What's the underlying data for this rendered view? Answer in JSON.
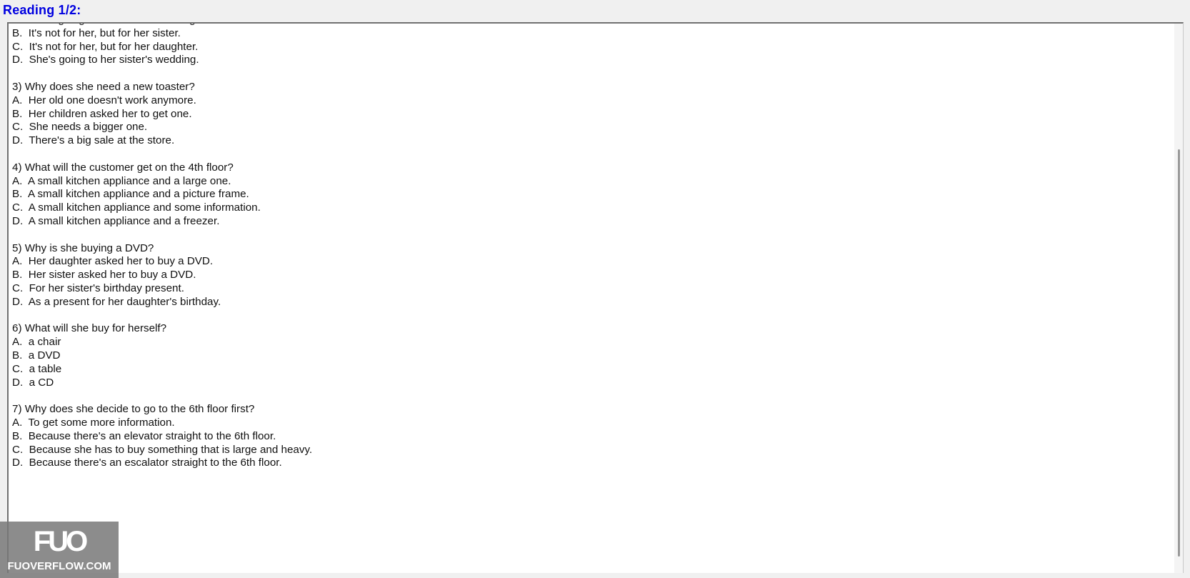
{
  "header": {
    "title": "Reading 1/2:"
  },
  "content": {
    "partial_top": "A.  She's going to her sister's wedding.",
    "questions": [
      {
        "question": null,
        "options": [
          "B.  It's not for her, but for her sister.",
          "C.  It's not for her, but for her daughter.",
          "D.  She's going to her sister's wedding."
        ]
      },
      {
        "question": "3) Why does she need a new toaster?",
        "options": [
          "A.  Her old one doesn't work anymore.",
          "B.  Her children asked her to get one.",
          "C.  She needs a bigger one.",
          "D.  There's a big sale at the store."
        ]
      },
      {
        "question": "4) What will the customer get on the 4th floor?",
        "options": [
          "A.  A small kitchen appliance and a large one.",
          "B.  A small kitchen appliance and a picture frame.",
          "C.  A small kitchen appliance and some information.",
          "D.  A small kitchen appliance and a freezer."
        ]
      },
      {
        "question": "5) Why is she buying a DVD?",
        "options": [
          "A.  Her daughter asked her to buy a DVD.",
          "B.  Her sister asked her to buy a DVD.",
          "C.  For her sister's birthday present.",
          "D.  As a present for her daughter's birthday."
        ]
      },
      {
        "question": "6) What will she buy for herself?",
        "options": [
          "A.  a chair",
          "B.  a DVD",
          "C.  a table",
          "D.  a CD"
        ]
      },
      {
        "question": "7) Why does she decide to go to the 6th floor first?",
        "options": [
          "A.  To get some more information.",
          "B.  Because there's an elevator straight to the 6th floor.",
          "C.  Because she has to buy something that is large and heavy.",
          "D.  Because there's an escalator straight to the 6th floor."
        ]
      }
    ]
  },
  "watermark": {
    "logo": "FUO",
    "text": "FUOVERFLOW.COM"
  }
}
